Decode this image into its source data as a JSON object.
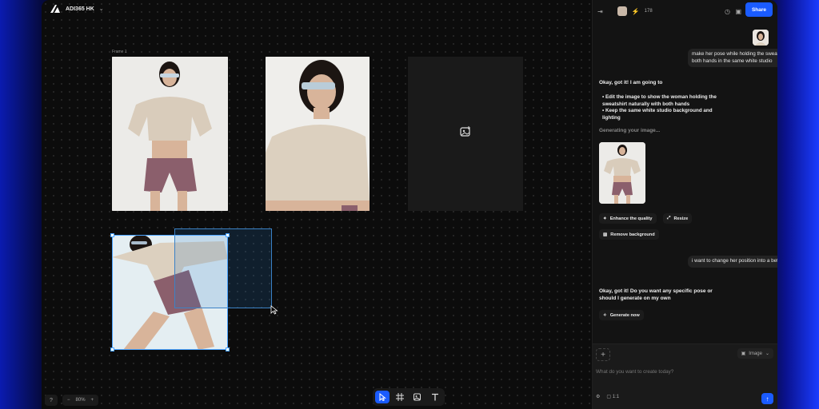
{
  "project": {
    "name": "ADI365 HK"
  },
  "canvas": {
    "frame_label": "Frame 1",
    "zoom": "80%",
    "help": "?",
    "zoom_out": "−",
    "zoom_in": "+"
  },
  "panel": {
    "credits": "178",
    "share_label": "Share",
    "messages": {
      "user1": "make her pose while holding the sweatshirt with both hands in the same white studio",
      "ai1_title": "Okay, got it! I am going to",
      "ai1_b1": "Edit the image to show the woman holding the sweatshirt naturally with both hands",
      "ai1_b2": "Keep the same white studio background and lighting",
      "generating": "Generating your image...",
      "user2": "i want to change her position into a better one",
      "ai2": "Okay, got it! Do you want any specific pose or should I generate on my own"
    },
    "chips": {
      "enhance": "Enhance the quality",
      "resize": "Resize",
      "remove_bg": "Remove background",
      "generate_now": "Generate now"
    },
    "composer": {
      "placeholder": "What do you want to create today?",
      "mode": "Image",
      "ratio": "1:1"
    }
  },
  "colors": {
    "accent": "#1a5bff",
    "selection": "#4aa3ff"
  },
  "icons": [
    "app-logo-icon",
    "chevron-down-icon",
    "sidebar-toggle-icon",
    "bolt-icon",
    "history-icon",
    "gallery-icon",
    "image-plus-icon",
    "select-tool-icon",
    "frame-tool-icon",
    "image-tool-icon",
    "text-tool-icon",
    "send-icon",
    "settings-icon"
  ]
}
